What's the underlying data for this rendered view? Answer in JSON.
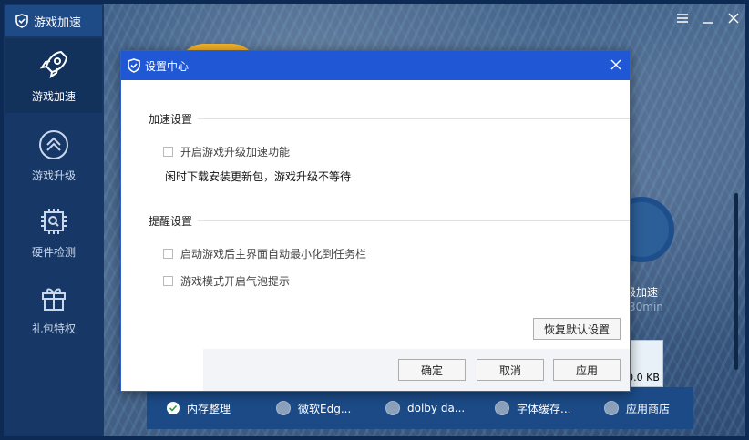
{
  "app": {
    "brand": "游戏加速"
  },
  "sidebar": {
    "items": [
      {
        "label": "游戏加速",
        "icon": "rocket-icon"
      },
      {
        "label": "游戏升级",
        "icon": "double-chevron-up-icon"
      },
      {
        "label": "硬件检测",
        "icon": "chip-icon"
      },
      {
        "label": "礼包特权",
        "icon": "gift-icon"
      }
    ]
  },
  "background": {
    "card_label": "级加速",
    "card_sub": "30min",
    "kb_value": "0.0 KB",
    "bottom_items": [
      {
        "label": "内存整理",
        "checked": true
      },
      {
        "label": "微软Edg...",
        "checked": false
      },
      {
        "label": "dolby da...",
        "checked": false
      },
      {
        "label": "字体缓存...",
        "checked": false
      },
      {
        "label": "应用商店",
        "checked": false
      }
    ]
  },
  "dialog": {
    "title": "设置中心",
    "sections": [
      {
        "title": "加速设置",
        "options": [
          {
            "label": "开启游戏升级加速功能",
            "checked": false
          }
        ],
        "note": "闲时下载安装更新包，游戏升级不等待"
      },
      {
        "title": "提醒设置",
        "options": [
          {
            "label": "启动游戏后主界面自动最小化到任务栏",
            "checked": false
          },
          {
            "label": "游戏模式开启气泡提示",
            "checked": false
          }
        ]
      }
    ],
    "restore_label": "恢复默认设置",
    "ok_label": "确定",
    "cancel_label": "取消",
    "apply_label": "应用"
  },
  "colors": {
    "title_bar": "#1f57d4",
    "sidebar": "#173866",
    "sidebar_active": "#12315b"
  }
}
